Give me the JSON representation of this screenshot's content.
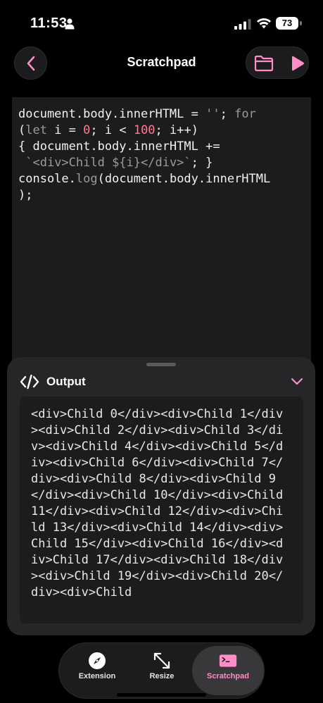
{
  "status_bar": {
    "time": "11:53",
    "battery": "73"
  },
  "nav": {
    "title": "Scratchpad"
  },
  "editor": {
    "tokens": [
      {
        "text": "document.body.innerHTML = ",
        "class": ""
      },
      {
        "text": "''",
        "class": "str"
      },
      {
        "text": "; ",
        "class": ""
      },
      {
        "text": "for",
        "class": "kw"
      },
      {
        "text": "\n(",
        "class": ""
      },
      {
        "text": "let",
        "class": "kw"
      },
      {
        "text": " i = ",
        "class": ""
      },
      {
        "text": "0",
        "class": "num"
      },
      {
        "text": "; i < ",
        "class": ""
      },
      {
        "text": "100",
        "class": "num"
      },
      {
        "text": "; i++)\n{ document.body.innerHTML +=\n ",
        "class": ""
      },
      {
        "text": "`<div>Child ${i}</div>`",
        "class": "str"
      },
      {
        "text": "; }\nconsole.",
        "class": ""
      },
      {
        "text": "log",
        "class": "kw"
      },
      {
        "text": "(document.body.innerHTML\n);",
        "class": ""
      }
    ]
  },
  "output": {
    "title": "Output",
    "text": "<div>Child 0</div><div>Child 1</div><div>Child 2</div><div>Child 3</div><div>Child 4</div><div>Child 5</div><div>Child 6</div><div>Child 7</div><div>Child 8</div><div>Child 9</div><div>Child 10</div><div>Child 11</div><div>Child 12</div><div>Child 13</div><div>Child 14</div><div>Child 15</div><div>Child 16</div><div>Child 17</div><div>Child 18</div><div>Child 19</div><div>Child 20</div><div>Child"
  },
  "tabs": [
    {
      "label": "Extension",
      "icon": "compass-icon"
    },
    {
      "label": "Resize",
      "icon": "resize-icon"
    },
    {
      "label": "Scratchpad",
      "icon": "terminal-icon",
      "active": true
    }
  ],
  "colors": {
    "accent": "#ff8dc7",
    "background": "#000000",
    "surface": "#1c1c1e"
  }
}
